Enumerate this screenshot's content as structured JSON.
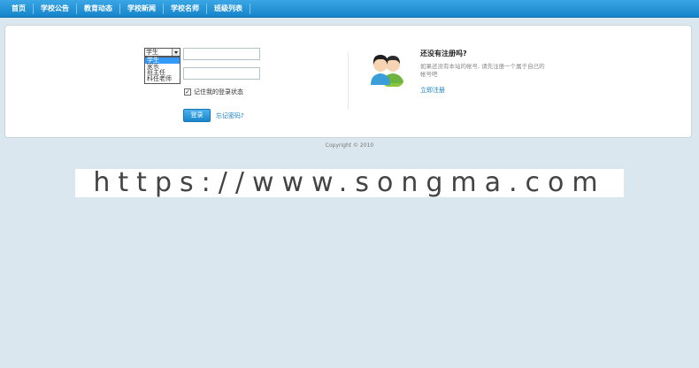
{
  "nav": {
    "items": [
      {
        "label": "首页"
      },
      {
        "label": "学校公告"
      },
      {
        "label": "教育动态"
      },
      {
        "label": "学校新闻"
      },
      {
        "label": "学校名师"
      },
      {
        "label": "班级列表"
      }
    ]
  },
  "login": {
    "role_selected": "学生",
    "role_options": [
      "学生",
      "家长",
      "班主任",
      "科任老师"
    ],
    "username_value": "",
    "password_value": "",
    "remember_label": "记住我的登录状态",
    "remember_checked": true,
    "login_button": "登录",
    "forgot_link": "忘记密码?"
  },
  "register": {
    "title": "还没有注册吗?",
    "description": "如果还没有本站的帐号, 请先注册一个属于自己的帐号吧",
    "link": "立即注册",
    "icon": "users-icon"
  },
  "footer": {
    "copyright": "Copyright © 2010"
  },
  "watermark": {
    "text": "https://www.songma.com"
  },
  "colors": {
    "nav_bg": "#1f8fd6",
    "link": "#1a7fc1",
    "page_bg": "#dbe7ee"
  }
}
